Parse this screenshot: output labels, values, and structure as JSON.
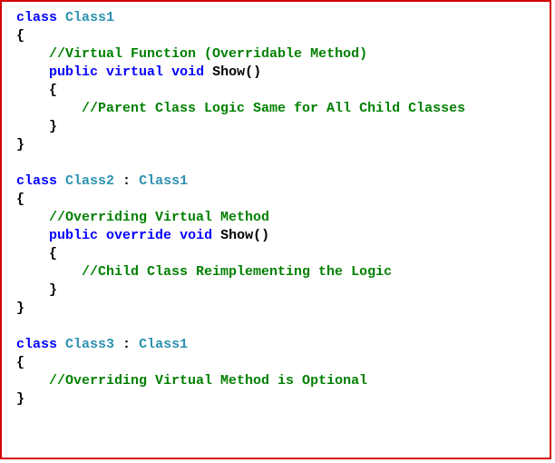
{
  "code": {
    "class1": {
      "kw_class": "class",
      "name": "Class1",
      "open": "{",
      "comment1": "//Virtual Function (Overridable Method)",
      "kw_public": "public",
      "kw_virtual": "virtual",
      "kw_void": "void",
      "method": "Show()",
      "open2": "{",
      "comment2": "//Parent Class Logic Same for All Child Classes",
      "close2": "}",
      "close": "}"
    },
    "class2": {
      "kw_class": "class",
      "name": "Class2",
      "sep": " : ",
      "base": "Class1",
      "open": "{",
      "comment1": "//Overriding Virtual Method",
      "kw_public": "public",
      "kw_override": "override",
      "kw_void": "void",
      "method": "Show()",
      "open2": "{",
      "comment2": "//Child Class Reimplementing the Logic",
      "close2": "}",
      "close": "}"
    },
    "class3": {
      "kw_class": "class",
      "name": "Class3",
      "sep": " : ",
      "base": "Class1",
      "open": "{",
      "comment1": "//Overriding Virtual Method is Optional",
      "close": "}"
    }
  }
}
